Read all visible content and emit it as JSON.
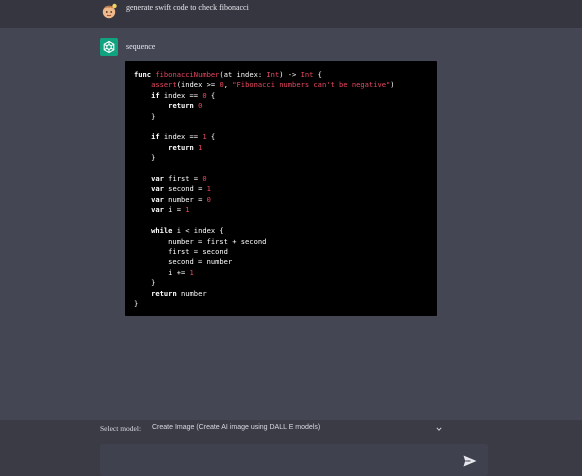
{
  "user_message": {
    "text": "generate swift code to check fibonacci",
    "avatar_icon": "user-avatar-icon"
  },
  "assistant_message": {
    "title": "sequence",
    "avatar_icon": "openai-logo-icon",
    "accent": "#10a37f",
    "code_lines": [
      "func fibonacciNumber(at index: Int) -> Int {",
      "    assert(index >= 0, \"Fibonacci numbers can't be negative\")",
      "    if index == 0 {",
      "        return 0",
      "    }",
      "",
      "    if index == 1 {",
      "        return 1",
      "    }",
      "",
      "    var first = 0",
      "    var second = 1",
      "    var number = 0",
      "    var i = 1",
      "",
      "    while i < index {",
      "        number = first + second",
      "        first = second",
      "        second = number",
      "        i += 1",
      "    }",
      "    return number",
      "}"
    ]
  },
  "model_selector": {
    "label": "Select model:",
    "selected": "Create Image (Create AI image using DALL E models)",
    "chevron_icon": "chevron-down-icon"
  },
  "input": {
    "placeholder": "",
    "value": "",
    "send_icon": "send-icon"
  }
}
